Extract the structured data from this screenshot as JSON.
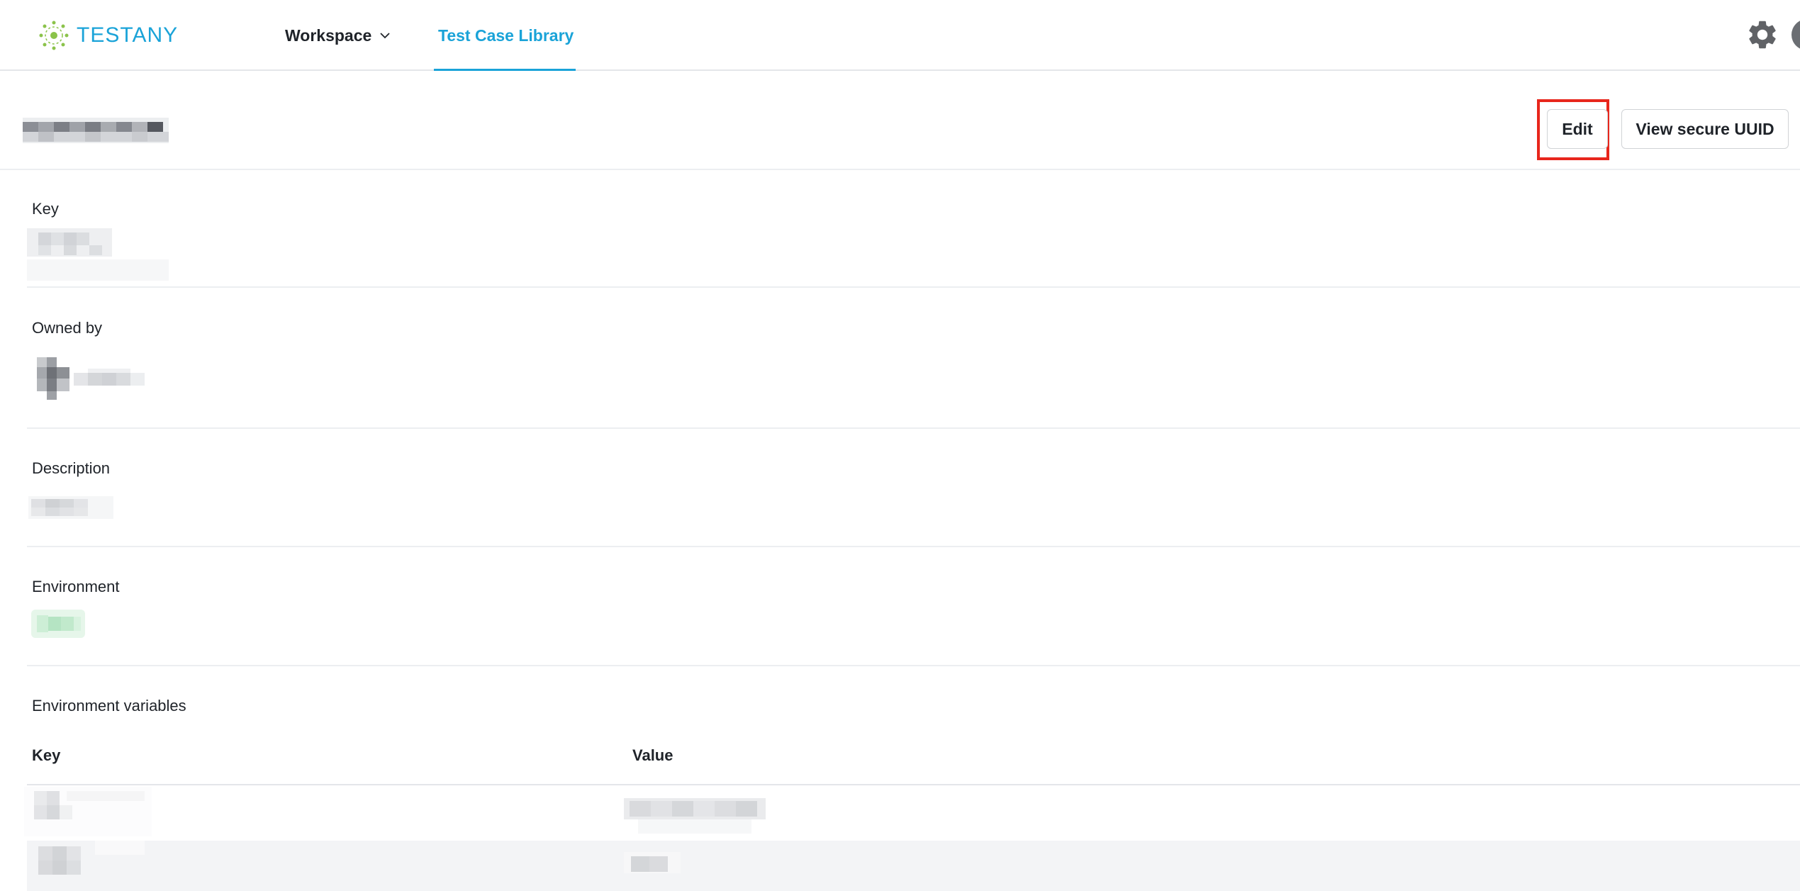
{
  "app": {
    "logo_text": "TESTANY"
  },
  "nav": {
    "workspace_label": "Workspace",
    "library_label": "Test Case Library"
  },
  "toolbar": {
    "edit_label": "Edit",
    "uuid_label": "View secure UUID"
  },
  "fields": {
    "key_label": "Key",
    "owner_label": "Owned by",
    "description_label": "Description",
    "environment_label": "Environment",
    "env_vars_label": "Environment variables"
  },
  "env_table": {
    "columns": [
      "Key",
      "Value"
    ]
  },
  "colors": {
    "accent": "#1aa3d8",
    "highlight": "#e8261c",
    "environment_tag": "#d6f2df"
  },
  "icons": [
    "testany-logo-icon",
    "chevron-down-icon",
    "gear-icon"
  ]
}
